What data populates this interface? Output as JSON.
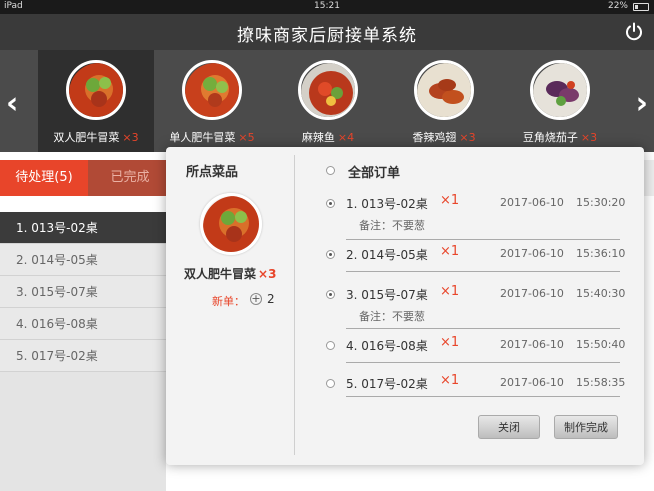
{
  "status_bar": {
    "device": "iPad",
    "time": "15:21",
    "battery": "22%",
    "battery_level": 0.22
  },
  "header": {
    "title": "撩味商家后厨接单系统",
    "power_icon": "power-icon"
  },
  "carousel": {
    "prev_icon": "chevron-left-icon",
    "next_icon": "chevron-right-icon",
    "dishes": [
      {
        "name": "双人肥牛冒菜",
        "qty": "×3",
        "active": true
      },
      {
        "name": "单人肥牛冒菜",
        "qty": "×5",
        "active": false
      },
      {
        "name": "麻辣鱼",
        "qty": "×4",
        "active": false
      },
      {
        "name": "香辣鸡翅",
        "qty": "×3",
        "active": false
      },
      {
        "name": "豆角烧茄子",
        "qty": "×3",
        "active": false
      }
    ]
  },
  "tabs": {
    "pending": "待处理(5)",
    "done": "已完成"
  },
  "order_list": [
    "1. 013号-02桌",
    "2. 014号-05桌",
    "3. 015号-07桌",
    "4. 016号-08桌",
    "5. 017号-02桌"
  ],
  "panel": {
    "left_title": "所点菜品",
    "dish_name": "双人肥牛冒菜",
    "dish_qty": "×3",
    "new_label": "新单：",
    "new_count": "2",
    "all_orders": "全部订单",
    "orders": [
      {
        "num": "1. 013号-02桌",
        "x": "×1",
        "date": "2017-06-10",
        "time": "15:30:20",
        "note": "备注：不要葱",
        "checked": true
      },
      {
        "num": "2. 014号-05桌",
        "x": "×1",
        "date": "2017-06-10",
        "time": "15:36:10",
        "note": "",
        "checked": true
      },
      {
        "num": "3. 015号-07桌",
        "x": "×1",
        "date": "2017-06-10",
        "time": "15:40:30",
        "note": "备注：不要葱",
        "checked": true
      },
      {
        "num": "4. 016号-08桌",
        "x": "×1",
        "date": "2017-06-10",
        "time": "15:50:40",
        "note": "",
        "checked": false
      },
      {
        "num": "5. 017号-02桌",
        "x": "×1",
        "date": "2017-06-10",
        "time": "15:58:35",
        "note": "",
        "checked": false
      }
    ],
    "close_label": "关闭",
    "finish_label": "制作完成"
  },
  "colors": {
    "accent": "#e8452a",
    "header": "#3a3a3a",
    "carousel": "#4b4b4b"
  }
}
